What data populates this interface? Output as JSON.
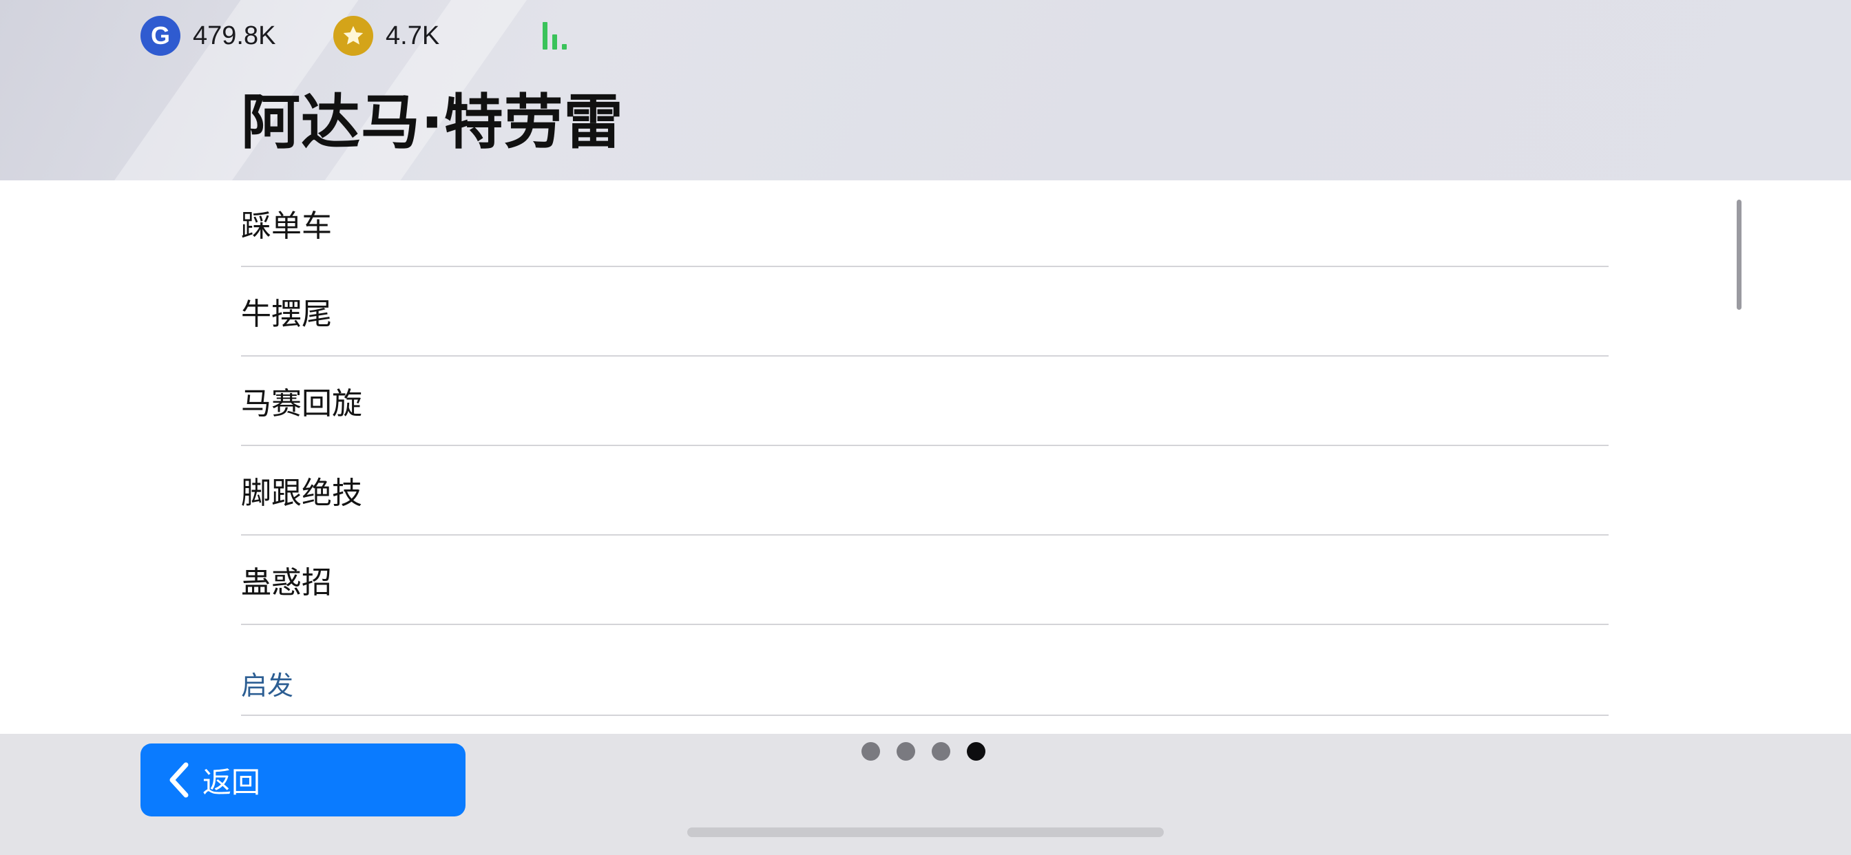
{
  "currencies": [
    {
      "icon": "g-coin-icon",
      "letter": "G",
      "value": "479.8K",
      "color": "#2f5bd0"
    },
    {
      "icon": "star-coin-icon",
      "value": "4.7K",
      "color": "#d4a419"
    }
  ],
  "signal": {
    "icon": "signal-strength-icon",
    "color": "#3ac35a"
  },
  "page": {
    "title": "阿达马·特劳雷"
  },
  "skills": [
    {
      "label": "踩单车"
    },
    {
      "label": "牛摆尾"
    },
    {
      "label": "马赛回旋"
    },
    {
      "label": "脚跟绝技"
    },
    {
      "label": "蛊惑招"
    }
  ],
  "section": {
    "label": "启发",
    "color": "#2c5e93"
  },
  "footer": {
    "back_label": "返回",
    "back_color": "#0a7bff",
    "page_dots": {
      "count": 4,
      "active_index": 3
    }
  }
}
